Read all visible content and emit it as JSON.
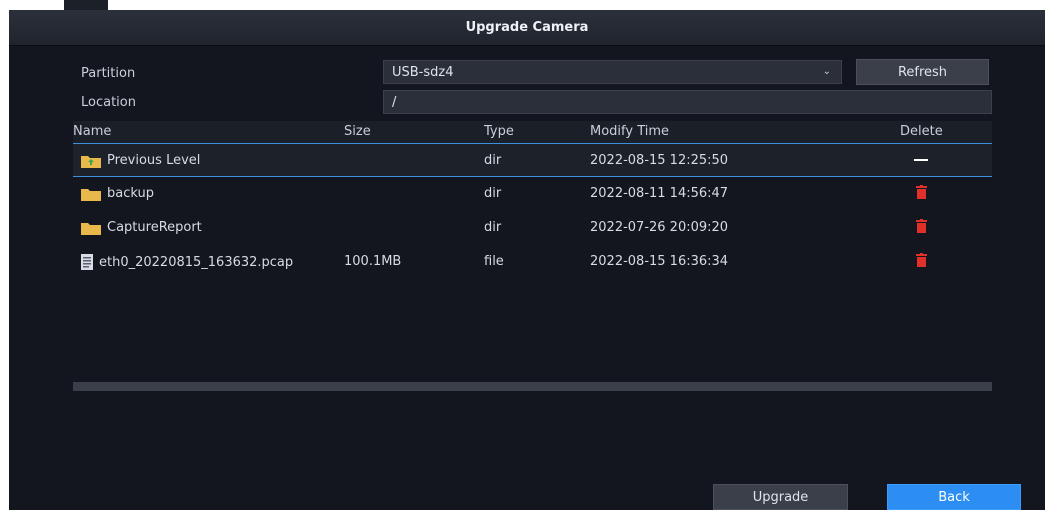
{
  "dialog": {
    "title": "Upgrade Camera"
  },
  "partition": {
    "label": "Partition",
    "value": "USB-sdz4"
  },
  "location": {
    "label": "Location",
    "value": "/"
  },
  "buttons": {
    "refresh": "Refresh",
    "upgrade": "Upgrade",
    "back": "Back"
  },
  "table": {
    "columns": {
      "name": "Name",
      "size": "Size",
      "type": "Type",
      "modify_time": "Modify Time",
      "delete": "Delete"
    },
    "rows": [
      {
        "name": "Previous Level",
        "size": "",
        "type": "dir",
        "modify_time": "2022-08-15 12:25:50",
        "icon": "folder-up-icon",
        "delete_icon": "dash-icon"
      },
      {
        "name": "backup",
        "size": "",
        "type": "dir",
        "modify_time": "2022-08-11 14:56:47",
        "icon": "folder-icon",
        "delete_icon": "trash-icon"
      },
      {
        "name": "CaptureReport",
        "size": "",
        "type": "dir",
        "modify_time": "2022-07-26 20:09:20",
        "icon": "folder-icon",
        "delete_icon": "trash-icon"
      },
      {
        "name": "eth0_20220815_163632.pcap",
        "size": "100.1MB",
        "type": "file",
        "modify_time": "2022-08-15 16:36:34",
        "icon": "file-icon",
        "delete_icon": "trash-icon"
      }
    ]
  },
  "colors": {
    "accent": "#2c8ef2",
    "delete": "#e0302a",
    "folder": "#e8b84a",
    "background": "#13161e"
  }
}
